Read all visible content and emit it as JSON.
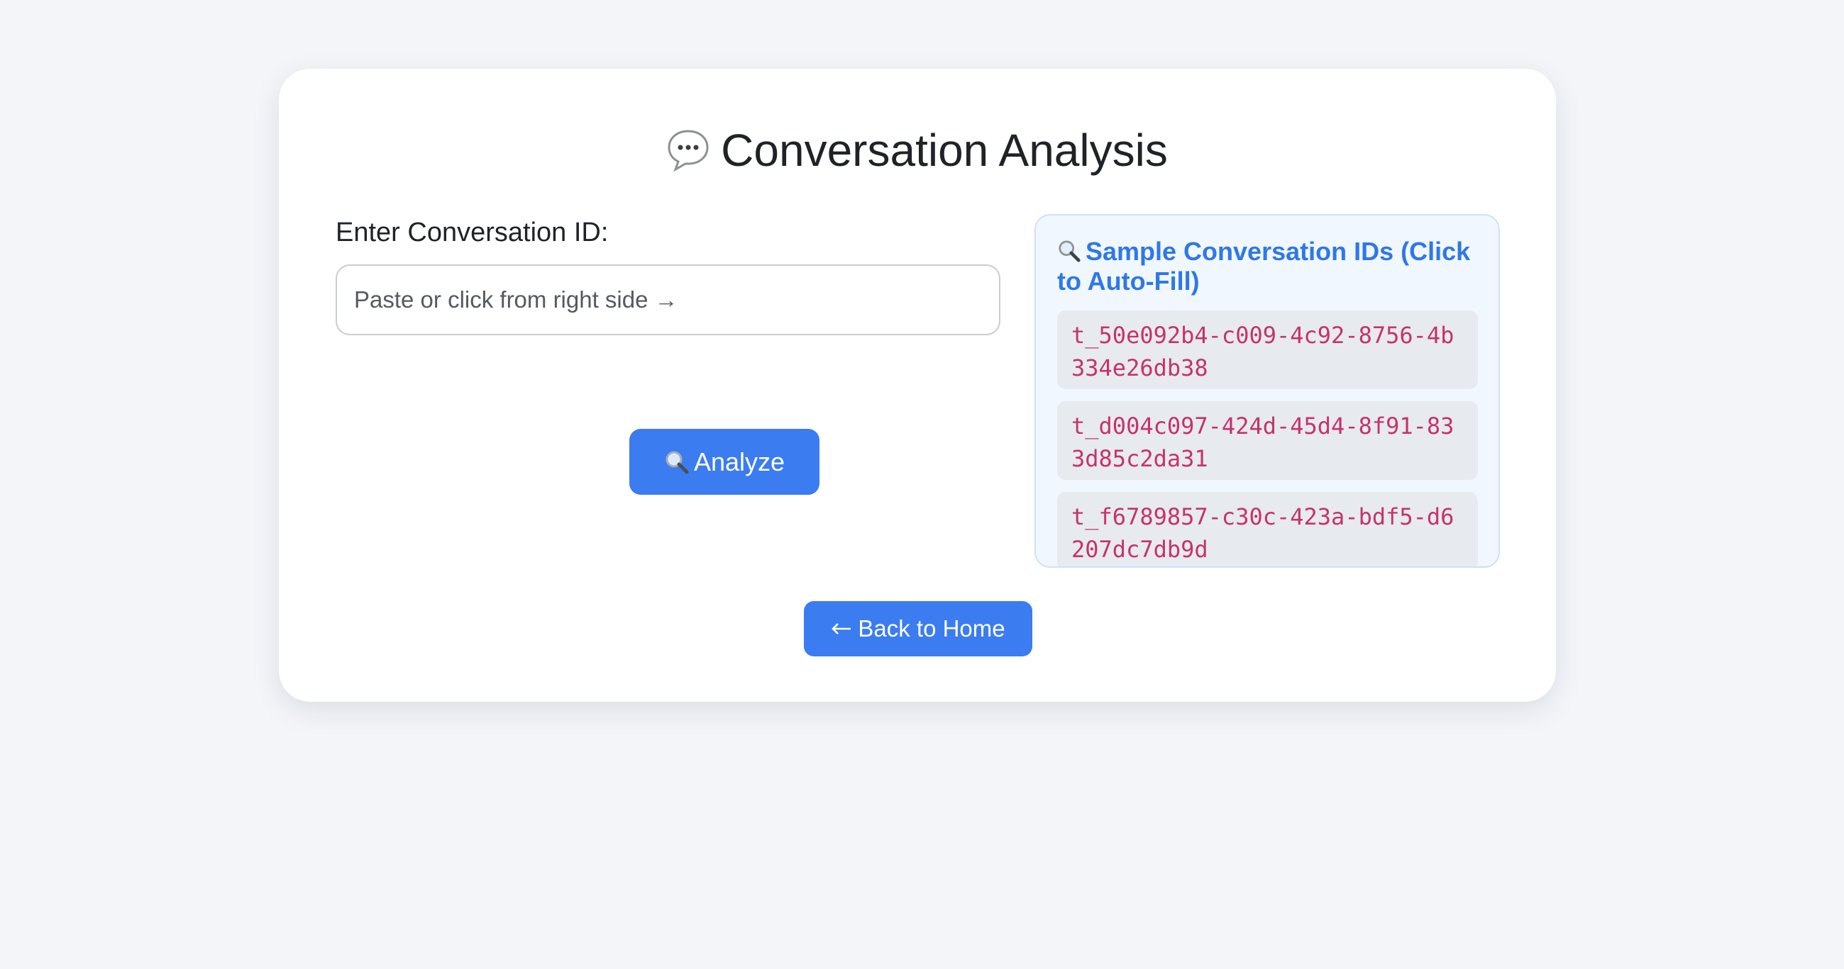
{
  "page": {
    "title": "Conversation Analysis",
    "title_icon": "speech-bubble-icon"
  },
  "form": {
    "label": "Enter Conversation ID:",
    "input_value": "",
    "input_placeholder": "Paste or click from right side →",
    "analyze_label": "Analyze",
    "analyze_icon": "magnifier-icon"
  },
  "samples": {
    "title": "Sample Conversation IDs (Click to Auto-Fill)",
    "title_icon": "magnifier-icon",
    "items": [
      "t_50e092b4-c009-4c92-8756-4b334e26db38",
      "t_d004c097-424d-45d4-8f91-833d85c2da31",
      "t_f6789857-c30c-423a-bdf5-d6207dc7db9d"
    ]
  },
  "nav": {
    "back_label": "Back to Home",
    "back_icon": "left-arrow-icon"
  },
  "colors": {
    "accent": "#3b7cf0",
    "sample_title": "#2f78e6",
    "sample_id_text": "#c4336e",
    "page_background": "#f3f5f9"
  }
}
